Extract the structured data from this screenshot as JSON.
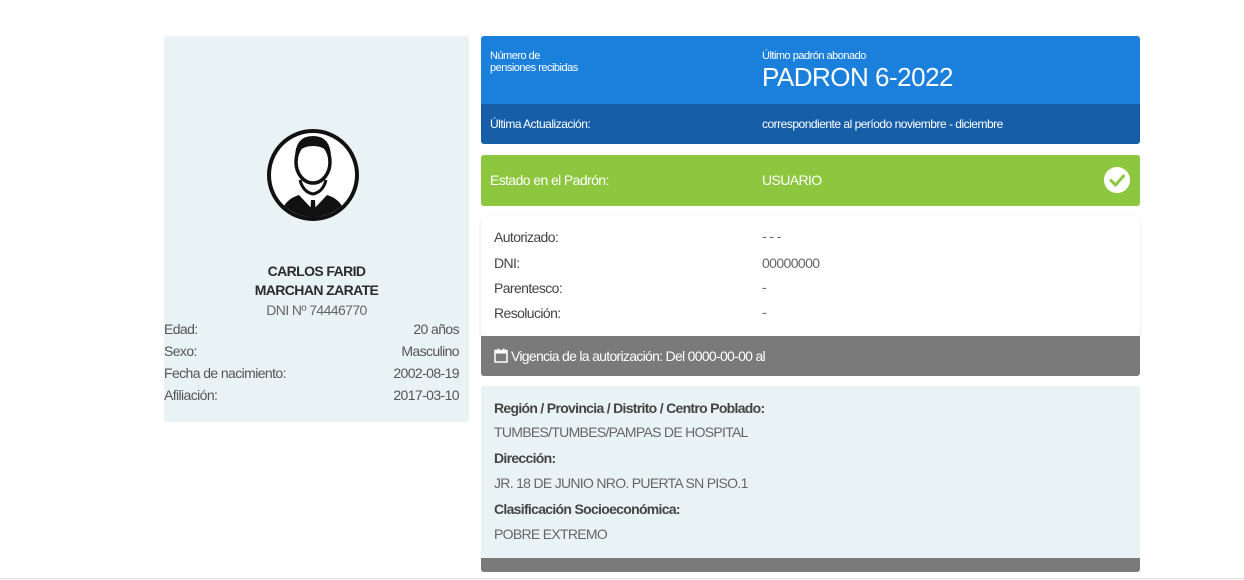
{
  "profile": {
    "first_name": "CARLOS FARID",
    "last_name": "MARCHAN ZARATE",
    "dni": "DNI Nº 74446770",
    "fields": [
      {
        "label": "Edad:",
        "value": "20 años"
      },
      {
        "label": "Sexo:",
        "value": "Masculino"
      },
      {
        "label": "Fecha de nacimiento:",
        "value": "2002-08-19"
      },
      {
        "label": "Afiliación:",
        "value": "2017-03-10"
      }
    ],
    "avatar_icon": "user-silhouette-icon"
  },
  "padron": {
    "pensions_label_line1": "Número de",
    "pensions_label_line2": "pensiones recibidas",
    "last_label": "Último padrón abonado",
    "last_value": "PADRON 6-2022",
    "update_label": "Última Actualización:",
    "update_value": "correspondiente al período noviembre - diciembre"
  },
  "estado": {
    "label": "Estado en el Padrón:",
    "value": "USUARIO",
    "icon": "check-circle-icon"
  },
  "autorizacion": {
    "rows": [
      {
        "label": "Autorizado:",
        "value": "- - -"
      },
      {
        "label": "DNI:",
        "value": "00000000"
      },
      {
        "label": "Parentesco:",
        "value": "-"
      },
      {
        "label": "Resolución:",
        "value": "-"
      }
    ],
    "vigencia": "Vigencia de la autorización: Del 0000-00-00 al",
    "vigencia_icon": "calendar-icon"
  },
  "ubicacion": {
    "region_label": "Región / Provincia / Distrito / Centro Poblado:",
    "region_value": "TUMBES/TUMBES/PAMPAS DE HOSPITAL",
    "direccion_label": "Dirección:",
    "direccion_value": "JR. 18 DE JUNIO NRO. PUERTA SN PISO.1",
    "clasificacion_label": "Clasificación Socioeconómica:",
    "clasificacion_value": "POBRE EXTREMO"
  },
  "colors": {
    "blue": "#1b7fdc",
    "dark_blue": "#165fa8",
    "green": "#8dc63f",
    "gray": "#7a7a7a",
    "card_bg": "#e9f3f5"
  }
}
